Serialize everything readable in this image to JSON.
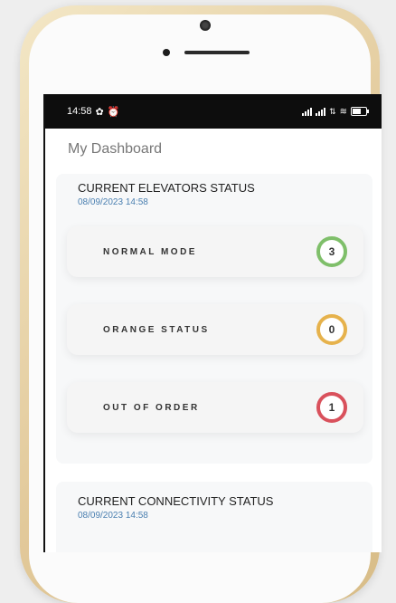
{
  "status_bar": {
    "time": "14:58",
    "left_icons": [
      "notification-icon",
      "alarm-icon"
    ],
    "right_icons": [
      "signal-icon",
      "signal-icon",
      "wifi-icon",
      "battery-icon"
    ]
  },
  "page_title": "My Dashboard",
  "elevators": {
    "title": "CURRENT ELEVATORS STATUS",
    "date": "08/09/2023 14:58",
    "rows": [
      {
        "label": "NORMAL MODE",
        "count": "3",
        "color": "#7fbf6a"
      },
      {
        "label": "ORANGE STATUS",
        "count": "0",
        "color": "#e6b24c"
      },
      {
        "label": "OUT OF ORDER",
        "count": "1",
        "color": "#d9515c"
      }
    ]
  },
  "connectivity": {
    "title": "CURRENT CONNECTIVITY STATUS",
    "date": "08/09/2023 14:58"
  }
}
